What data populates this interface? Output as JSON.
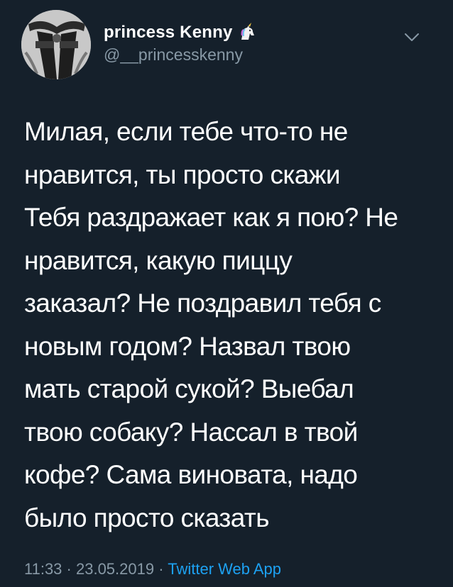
{
  "user": {
    "display_name": "princess Kenny",
    "handle": "@__princesskenny",
    "emoji_icon": "unicorn-icon"
  },
  "tweet": {
    "lines": [
      "Милая, если тебе что-то не",
      "нравится, ты просто скажи",
      "Тебя раздражает как я пою? Не",
      "нравится, какую пиццу",
      "заказал? Не поздравил тебя с",
      "новым годом? Назвал твою",
      "мать старой сукой? Выебал",
      "твою собаку? Нассал в твой",
      "кофе? Сама виновата, надо",
      "было просто сказать"
    ]
  },
  "meta": {
    "time": "11:33",
    "sep1": " · ",
    "date": "23.05.2019",
    "sep2": " · ",
    "source": "Twitter Web App"
  },
  "colors": {
    "background": "#15202b",
    "text": "#ffffff",
    "secondary": "#8899a6",
    "link": "#1da1f2"
  }
}
